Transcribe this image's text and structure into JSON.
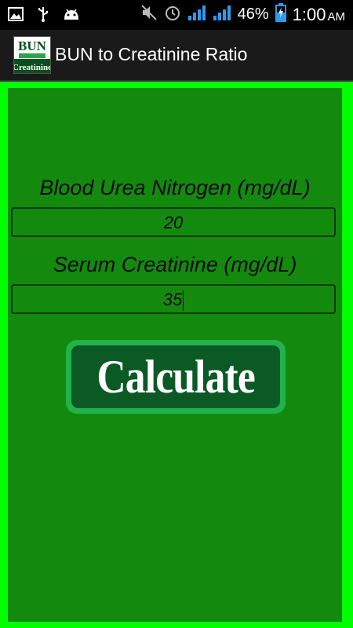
{
  "status_bar": {
    "battery_percent": "46%",
    "time": "1:00",
    "ampm": "AM",
    "icons": [
      "image-icon",
      "usb-icon",
      "android-icon",
      "mute-icon",
      "alarm-icon",
      "signal-icon",
      "signal-icon",
      "battery-charging-icon"
    ]
  },
  "action_bar": {
    "logo_top": "BUN",
    "logo_bottom": "Creatinine",
    "title": "BUN to Creatinine Ratio"
  },
  "form": {
    "bun_label": "Blood Urea Nitrogen (mg/dL)",
    "bun_value": "20",
    "creatinine_label": "Serum Creatinine (mg/dL)",
    "creatinine_value": "35",
    "calculate_label": "Calculate"
  },
  "colors": {
    "outer_border": "#00ff00",
    "panel": "#138a0e",
    "button_outer": "#22b24c",
    "button_inner": "#0b5a26"
  }
}
